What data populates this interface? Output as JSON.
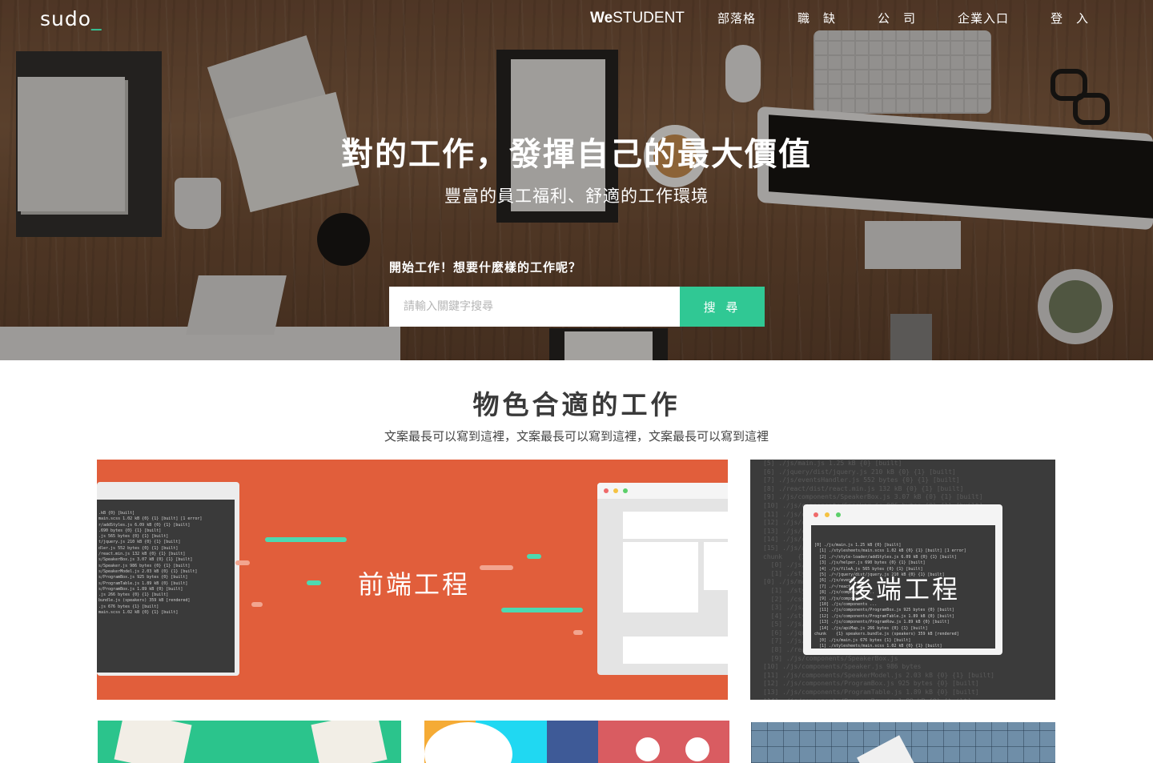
{
  "nav": {
    "logo": "sudo",
    "logo_cursor": "_",
    "westudent_bold": "We",
    "westudent_light": "STUDENT",
    "items": [
      {
        "label": "部落格"
      },
      {
        "label": "職　缺"
      },
      {
        "label": "公　司"
      },
      {
        "label": "企業入口"
      },
      {
        "label": "登　入"
      }
    ]
  },
  "hero": {
    "title": "對的工作，發揮自己的最大價值",
    "subtitle": "豐富的員工福利、舒適的工作環境",
    "search_prompt": "開始工作！想要什麼樣的工作呢？",
    "search_placeholder": "請輸入關鍵字搜尋",
    "search_button": "搜 尋"
  },
  "section": {
    "title": "物色合適的工作",
    "description": "文案最長可以寫到這裡，文案最長可以寫到這裡，文案最長可以寫到這裡"
  },
  "categories": [
    {
      "label": "前端工程"
    },
    {
      "label": "後端工程"
    }
  ],
  "colors": {
    "accent": "#30c894",
    "frontend_card": "#e15e3b",
    "backend_card": "#3b3b3b",
    "green_card": "#2bc48c"
  }
}
